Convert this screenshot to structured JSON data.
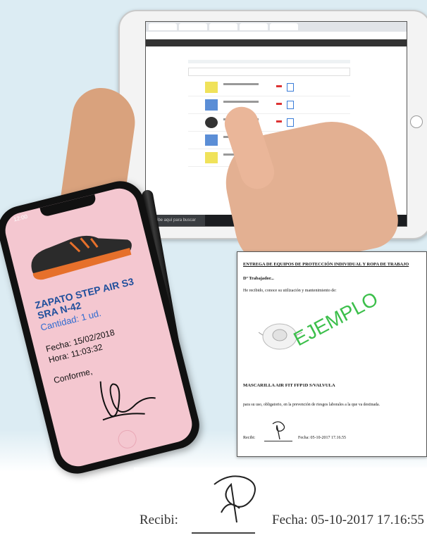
{
  "phone": {
    "status_time": "12:00",
    "product_title": "ZAPATO STEP AIR S3 SRA N-42",
    "quantity": "Cantidad: 1 ud.",
    "date": "Fecha: 15/02/2018",
    "time": "Hora: 11:03:32",
    "conform": "Conforme,"
  },
  "document": {
    "header": "ENTREGA DE EQUIPOS DE PROTECCIÓN INDIVIDUAL Y ROPA DE TRABAJO",
    "worker": "Dº Trabajador...",
    "received_text": "He recibido, conoce su utilización y mantenimiento de:",
    "watermark": "EJEMPLO",
    "product": "MASCARILLA AIR FIT FFP1D S/VALVULA",
    "usage_text": "para su uso, obligatorio, en la prevención de riesgos laborales a la que va destinada.",
    "recibi": "Recibi:",
    "fecha": "Fecha: 05-10-2017 17.16.55"
  },
  "zoom": {
    "recibi": "Recibi:",
    "fecha": "Fecha: 05-10-2017 17.16:55"
  },
  "tablet": {
    "taskbar_search": "Escribe aquí para buscar"
  },
  "colors": {
    "background": "#dcecf3",
    "phone_screen": "#f4c7d0",
    "title_blue": "#1f4f9c",
    "watermark_green": "#3cbf4b"
  }
}
